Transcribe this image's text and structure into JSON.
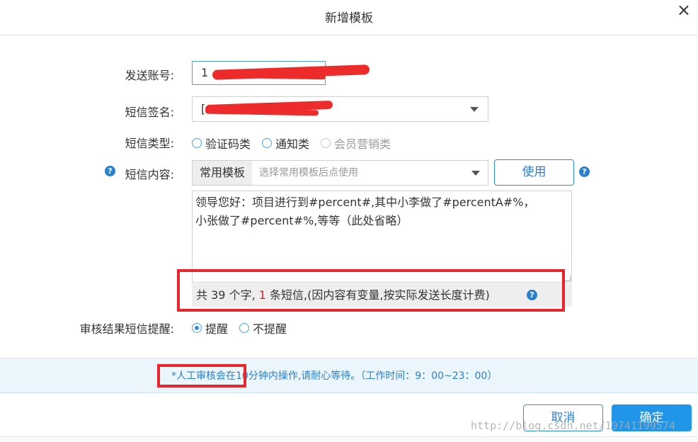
{
  "dialog": {
    "title": "新增模板",
    "close_glyph": "×"
  },
  "form": {
    "account": {
      "label": "发送账号:",
      "value": "1"
    },
    "signature": {
      "label": "短信签名:",
      "value": "["
    },
    "type": {
      "label": "短信类型:",
      "options": [
        {
          "label": "验证码类",
          "checked": false,
          "disabled": false
        },
        {
          "label": "通知类",
          "checked": false,
          "disabled": false
        },
        {
          "label": "会员营销类",
          "checked": false,
          "disabled": true
        }
      ]
    },
    "content": {
      "label": "短信内容:",
      "template_prefix": "常用模板",
      "template_placeholder": "选择常用模板后点使用",
      "use_button": "使用",
      "text_line1": "领导您好：项目进行到#percent#,其中小李做了#percentA#%，",
      "text_line2": "小张做了#percent#%,等等（此处省略）",
      "counter": {
        "prefix": "共",
        "chars": "39",
        "chars_unit": "个字,",
        "sms": "1",
        "sms_unit": "条短信",
        "note": ",(因内容有变量,按实际发送长度计费)"
      }
    },
    "review": {
      "label": "审核结果短信提醒:",
      "options": [
        {
          "label": "提醒",
          "checked": true
        },
        {
          "label": "不提醒",
          "checked": false
        }
      ]
    }
  },
  "notice": {
    "text": "*人工审核会在10分钟内操作,请耐心等待。（工作时间：9：00~23：00）"
  },
  "footer": {
    "cancel": "取消",
    "ok": "确定"
  },
  "watermark": "http://blog.csdn.net/19741199574",
  "colors": {
    "accent": "#2196e8",
    "highlight_box": "#e8262b",
    "notice_bg": "#eaf5fc"
  }
}
